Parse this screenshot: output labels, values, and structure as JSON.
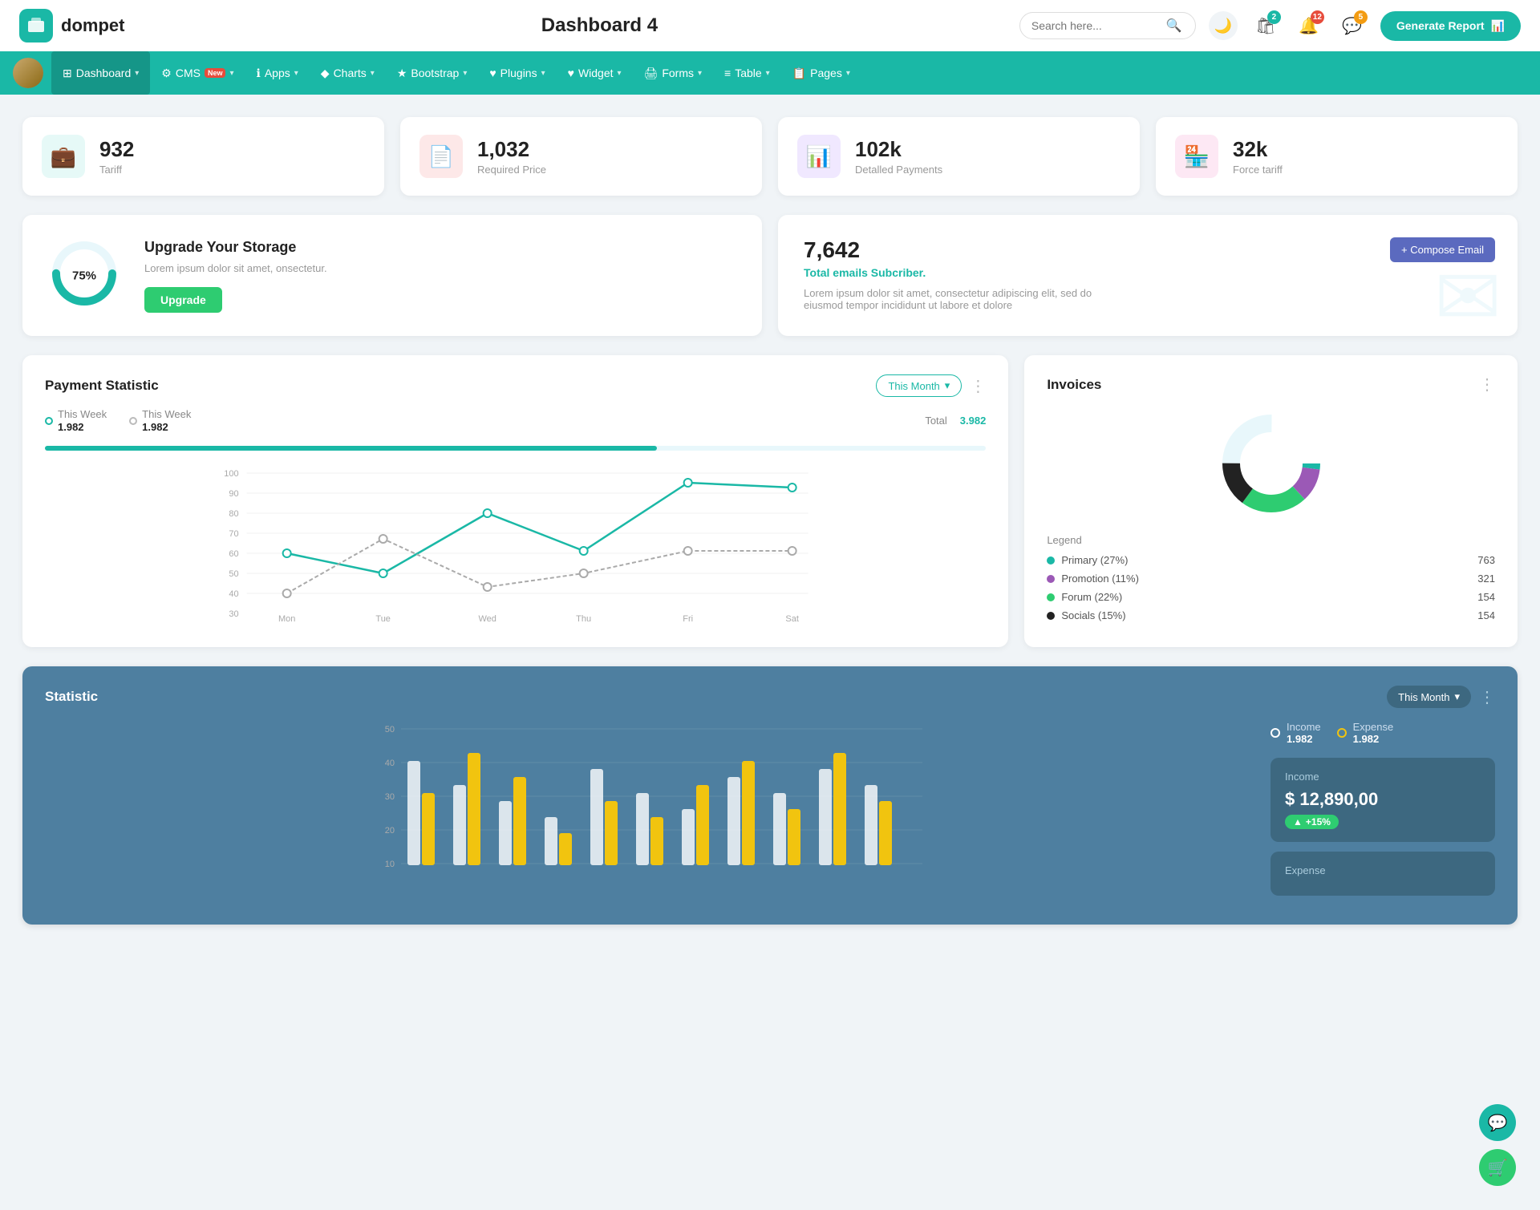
{
  "header": {
    "logo_text": "dompet",
    "title": "Dashboard 4",
    "search_placeholder": "Search here...",
    "generate_btn": "Generate Report",
    "badge_cart": "2",
    "badge_bell": "12",
    "badge_chat": "5"
  },
  "nav": {
    "items": [
      {
        "label": "Dashboard",
        "icon": "⊞",
        "active": true,
        "has_chevron": true
      },
      {
        "label": "CMS",
        "icon": "⚙",
        "active": false,
        "has_chevron": true,
        "badge": "New"
      },
      {
        "label": "Apps",
        "icon": "ℹ",
        "active": false,
        "has_chevron": true
      },
      {
        "label": "Charts",
        "icon": "◆",
        "active": false,
        "has_chevron": true
      },
      {
        "label": "Bootstrap",
        "icon": "★",
        "active": false,
        "has_chevron": true
      },
      {
        "label": "Plugins",
        "icon": "♥",
        "active": false,
        "has_chevron": true
      },
      {
        "label": "Widget",
        "icon": "♥",
        "active": false,
        "has_chevron": true
      },
      {
        "label": "Forms",
        "icon": "🖨",
        "active": false,
        "has_chevron": true
      },
      {
        "label": "Table",
        "icon": "≡",
        "active": false,
        "has_chevron": true
      },
      {
        "label": "Pages",
        "icon": "📋",
        "active": false,
        "has_chevron": true
      }
    ]
  },
  "stat_cards": [
    {
      "value": "932",
      "label": "Tariff",
      "icon": "💼",
      "icon_class": "icon-teal"
    },
    {
      "value": "1,032",
      "label": "Required Price",
      "icon": "📄",
      "icon_class": "icon-red"
    },
    {
      "value": "102k",
      "label": "Detalled Payments",
      "icon": "📊",
      "icon_class": "icon-purple"
    },
    {
      "value": "32k",
      "label": "Force tariff",
      "icon": "🏪",
      "icon_class": "icon-pink"
    }
  ],
  "storage": {
    "percent": 75,
    "percent_label": "75%",
    "title": "Upgrade Your Storage",
    "description": "Lorem ipsum dolor sit amet, onsectetur.",
    "btn_label": "Upgrade"
  },
  "email": {
    "value": "7,642",
    "sub": "Total emails Subcriber.",
    "description": "Lorem ipsum dolor sit amet, consectetur adipiscing elit, sed do eiusmod tempor incididunt ut labore et dolore",
    "compose_btn": "+ Compose Email"
  },
  "payment": {
    "title": "Payment Statistic",
    "month_btn": "This Month",
    "legend": [
      {
        "label": "This Week",
        "value": "1.982",
        "color": "teal"
      },
      {
        "label": "This Week",
        "value": "1.982",
        "color": "gray"
      }
    ],
    "total_label": "Total",
    "total_value": "3.982",
    "x_labels": [
      "Mon",
      "Tue",
      "Wed",
      "Thu",
      "Fri",
      "Sat"
    ],
    "y_labels": [
      "100",
      "90",
      "80",
      "70",
      "60",
      "50",
      "40",
      "30"
    ]
  },
  "invoices": {
    "title": "Invoices",
    "legend": "Legend",
    "items": [
      {
        "label": "Primary (27%)",
        "color": "#1ab8a6",
        "value": "763"
      },
      {
        "label": "Promotion (11%)",
        "color": "#9b59b6",
        "value": "321"
      },
      {
        "label": "Forum (22%)",
        "color": "#2ecc71",
        "value": "154"
      },
      {
        "label": "Socials (15%)",
        "color": "#222",
        "value": "154"
      }
    ]
  },
  "statistic": {
    "title": "Statistic",
    "month_btn": "This Month",
    "y_labels": [
      "50",
      "40",
      "30",
      "20",
      "10"
    ],
    "legend": [
      {
        "label": "Income",
        "value": "1.982",
        "color": "white"
      },
      {
        "label": "Expense",
        "value": "1.982",
        "color": "#f1c40f"
      }
    ],
    "income_box": {
      "title": "Income",
      "value": "$ 12,890,00",
      "badge": "+15%"
    },
    "expense_box": {
      "title": "Expense"
    }
  }
}
